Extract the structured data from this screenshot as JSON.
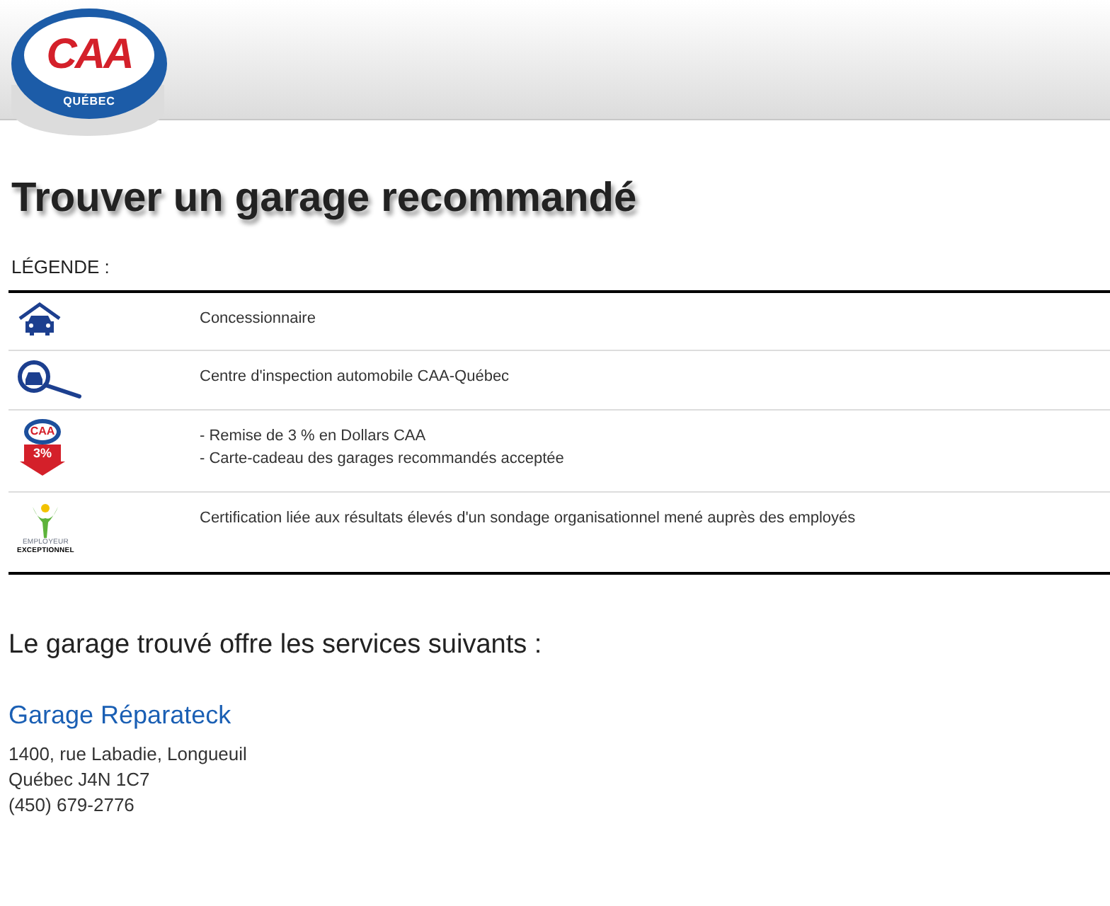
{
  "header": {
    "logo": {
      "mark": "CAA",
      "region": "QUÉBEC"
    }
  },
  "page_title": "Trouver un garage recommandé",
  "legend": {
    "label": "LÉGENDE :",
    "rows": [
      {
        "kind": "dealer",
        "lines": [
          "Concessionnaire"
        ]
      },
      {
        "kind": "inspection",
        "lines": [
          "Centre d'inspection automobile CAA-Québec"
        ]
      },
      {
        "kind": "discount",
        "badge": {
          "mark": "CAA",
          "value": "3%"
        },
        "lines": [
          "- Remise de 3 % en Dollars CAA",
          "- Carte-cadeau des garages recommandés acceptée"
        ]
      },
      {
        "kind": "employer",
        "badge": {
          "line_1": "EMPLOYEUR",
          "line_2": "EXCEPTIONNEL"
        },
        "lines": [
          "Certification liée aux résultats élevés d'un sondage organisationnel mené auprès des employés"
        ]
      }
    ]
  },
  "services_heading": "Le garage trouvé offre les services suivants :",
  "garage": {
    "name": "Garage Réparateck",
    "address_lines": [
      "1400, rue Labadie, Longueuil",
      "Québec J4N 1C7",
      "(450) 679-2776"
    ]
  }
}
